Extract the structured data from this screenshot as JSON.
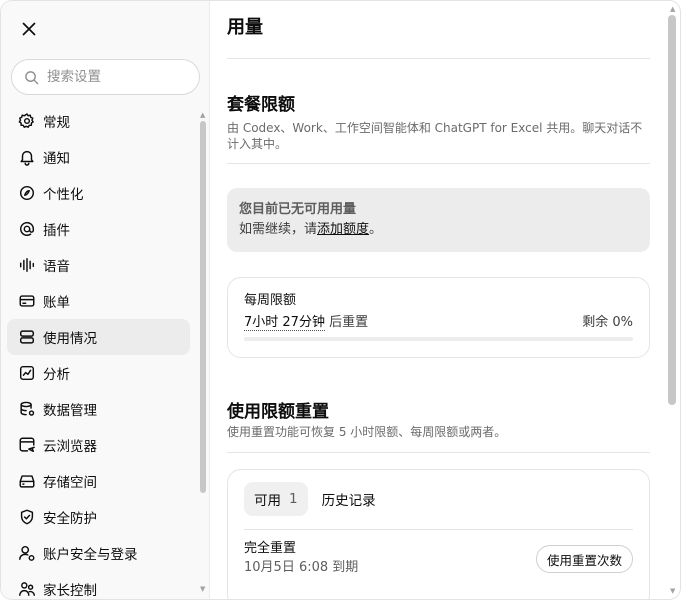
{
  "sidebar": {
    "search_placeholder": "搜索设置",
    "items": [
      {
        "label": "常规",
        "icon": "gear-icon"
      },
      {
        "label": "通知",
        "icon": "bell-icon"
      },
      {
        "label": "个性化",
        "icon": "personalize-icon"
      },
      {
        "label": "插件",
        "icon": "plugin-icon"
      },
      {
        "label": "语音",
        "icon": "waveform-icon"
      },
      {
        "label": "账单",
        "icon": "card-icon"
      },
      {
        "label": "使用情况",
        "icon": "usage-icon"
      },
      {
        "label": "分析",
        "icon": "chart-icon"
      },
      {
        "label": "数据管理",
        "icon": "database-icon"
      },
      {
        "label": "云浏览器",
        "icon": "cloud-browser-icon"
      },
      {
        "label": "存储空间",
        "icon": "storage-icon"
      },
      {
        "label": "安全防护",
        "icon": "shield-icon"
      },
      {
        "label": "账户安全与登录",
        "icon": "account-icon"
      },
      {
        "label": "家长控制",
        "icon": "family-icon"
      }
    ],
    "active_item": "使用情况"
  },
  "main": {
    "title": "用量",
    "plan": {
      "title": "套餐限额",
      "desc": "由 Codex、Work、工作空间智能体和 ChatGPT for Excel 共用。聊天对话不计入其中。"
    },
    "alert": {
      "title": "您目前已无可用用量",
      "text_prefix": "如需继续，请",
      "link": "添加额度",
      "text_suffix": "。"
    },
    "weekly": {
      "label": "每周限额",
      "time": "7小时 27分钟",
      "reset_suffix": " 后重置",
      "remaining": "剩余 0%",
      "remaining_fraction": 0
    },
    "reset": {
      "title": "使用限额重置",
      "desc": "使用重置功能可恢复 5 小时限额、每周限额或两者。",
      "tab_available": "可用",
      "tab_available_count": "1",
      "tab_history": "历史记录",
      "item_title": "完全重置",
      "item_expiry": "10月5日 6:08 到期",
      "button": "使用重置次数"
    }
  }
}
